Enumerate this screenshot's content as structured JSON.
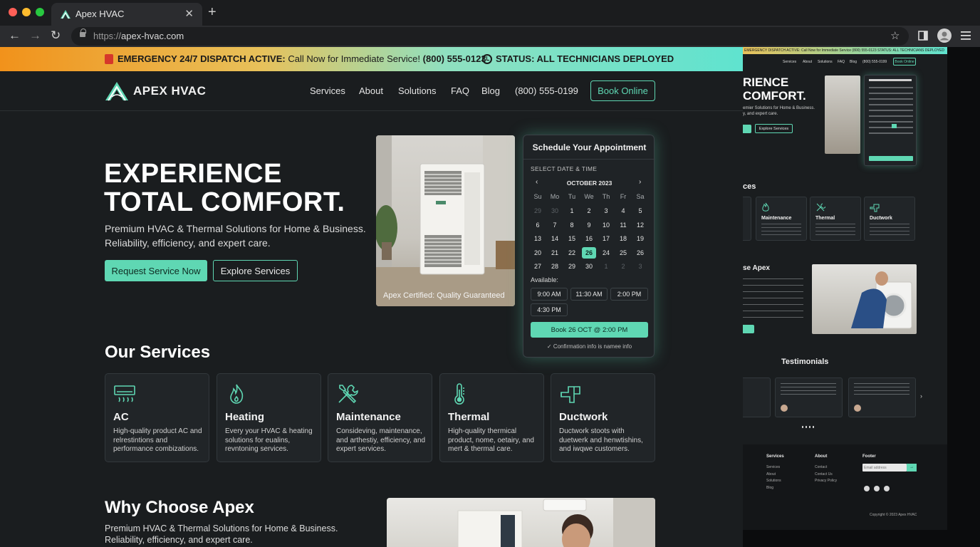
{
  "browser": {
    "tab_title": "Apex HVAC",
    "url_scheme": "https://",
    "url_host": "apex-hvac.com"
  },
  "banner": {
    "emergency_label": "EMERGENCY 24/7 DISPATCH ACTIVE:",
    "emergency_text": "Call Now for Immediate Service!",
    "emergency_phone": "(800) 555-0123",
    "status_text": "STATUS: ALL TECHNICIANS DEPLOYED"
  },
  "header": {
    "brand": "APEX HVAC",
    "nav": [
      "Services",
      "About",
      "Solutions",
      "FAQ",
      "Blog"
    ],
    "phone": "(800) 555-0199",
    "cta": "Book Online"
  },
  "hero": {
    "title_line1": "EXPERIENCE",
    "title_line2": "TOTAL COMFORT.",
    "subtitle_line1": "Premium HVAC & Thermal Solutions for Home & Business.",
    "subtitle_line2": "Reliability, efficiency, and expert care.",
    "primary_button": "Request Service Now",
    "secondary_button": "Explore Services",
    "photo_caption": "Apex Certified: Quality Guaranteed"
  },
  "appointment": {
    "title": "Schedule Your Appointment",
    "section_label": "SELECT DATE & TIME",
    "month": "OCTOBER 2023",
    "weekdays": [
      "Su",
      "Mo",
      "Tu",
      "We",
      "Th",
      "Fr",
      "Sa"
    ],
    "days": [
      [
        "29",
        "30",
        "1",
        "2",
        "3",
        "4",
        "5"
      ],
      [
        "6",
        "7",
        "8",
        "9",
        "10",
        "11",
        "12"
      ],
      [
        "13",
        "14",
        "15",
        "16",
        "17",
        "18",
        "19"
      ],
      [
        "20",
        "21",
        "22",
        "26",
        "24",
        "25",
        "26"
      ],
      [
        "27",
        "28",
        "29",
        "30",
        "1",
        "2",
        "3"
      ]
    ],
    "selected_day": "26",
    "available_label": "Available:",
    "slots": [
      "9:00 AM",
      "11:30 AM",
      "2:00 PM",
      "4:30 PM"
    ],
    "book_button": "Book 26 OCT @ 2:00 PM",
    "confirmation": "Confirmation info is namee info"
  },
  "services": {
    "title": "Our Services",
    "items": [
      {
        "name": "AC",
        "desc": "High-quality product AC and relrestintions and performance combizations.",
        "icon": "ac-unit-icon"
      },
      {
        "name": "Heating",
        "desc": "Every your HVAC & heating solutions for eualins, revntoning services.",
        "icon": "flame-icon"
      },
      {
        "name": "Maintenance",
        "desc": "Consideving, maintenance, and arthestiy, efficiency, and expert services.",
        "icon": "wrench-icon"
      },
      {
        "name": "Thermal",
        "desc": "High-quality thermical product, nome, oetairy, and mert & thermal care.",
        "icon": "thermometer-icon"
      },
      {
        "name": "Ductwork",
        "desc": "Ductwork stoots with duetwerk and henwtishins, and iwqwe customers.",
        "icon": "duct-icon"
      }
    ]
  },
  "why": {
    "title": "Why Choose Apex",
    "subtitle": "Premium HVAC & Thermal Solutions for Home & Business. Reliability, efficiency, and expert care."
  },
  "overlay": {
    "banner_text": "EMERGENCY DISPATCH ACTIVE: Call Now for Immediate Service (800) 555-0123   STATUS: ALL TECHNICIANS DEPLOYED",
    "nav": [
      "Services",
      "About",
      "Solutions",
      "FAQ",
      "Blog",
      "(800) 555-0199"
    ],
    "book": "Book Online",
    "hero_line1": "RIENCE",
    "hero_line2": " COMFORT.",
    "hero_sub_line1": "emier Solutions for Home & Business.",
    "hero_sub_line2": "y, and expert care.",
    "explore": "Explore Services",
    "services_title": "ces",
    "cards": [
      "Maintenance",
      "Thermal",
      "Ductwork"
    ],
    "why_title": "se Apex",
    "testimonials_title": "Testimonials",
    "footer_cols": [
      "Services",
      "About",
      "Footer"
    ],
    "footer_services": [
      "Services",
      "About",
      "Solutions",
      "Blog"
    ],
    "footer_about": [
      "Contact",
      "Contact Us",
      "Privacy Policy"
    ],
    "footer_email_placeholder": "Email address",
    "copyright": "Copyright © 2023 Apex HVAC"
  }
}
